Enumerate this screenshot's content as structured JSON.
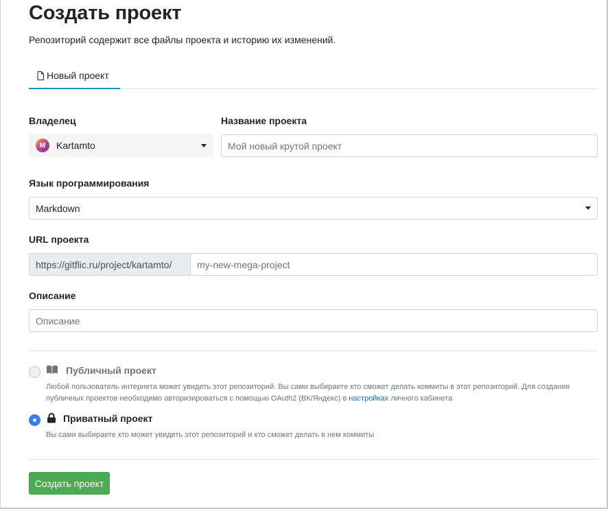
{
  "page": {
    "title": "Создать проект",
    "subtitle": "Репозиторий содержит все файлы проекта и историю их изменений."
  },
  "tabs": [
    {
      "label": "Новый проект",
      "active": true
    }
  ],
  "form": {
    "owner": {
      "label": "Владелец",
      "avatar_letter": "M",
      "value": "Kartamto"
    },
    "project_name": {
      "label": "Название проекта",
      "placeholder": "Мой новый крутой проект"
    },
    "language": {
      "label": "Язык программирования",
      "value": "Markdown"
    },
    "url": {
      "label": "URL проекта",
      "prefix": "https://gitflic.ru/project/kartamto/",
      "placeholder": "my-new-mega-project"
    },
    "description": {
      "label": "Описание",
      "placeholder": "Описание"
    }
  },
  "visibility": {
    "public": {
      "title": "Публичный проект",
      "icon": "book-icon",
      "selected": false,
      "description_line1": "Любой пользователь интернета может увидеть этот репозиторий. Вы сами выбираете кто сможет делать коммиты в этот репозиторий. Для создания",
      "description_line2_before": "публичных проектов необходимо авторизироваться с помощью OAuth2 (ВК/Яндекс) в ",
      "description_link": "настройках",
      "description_line2_after": " личного кабинета"
    },
    "private": {
      "title": "Приватный проект",
      "icon": "lock-icon",
      "selected": true,
      "description": "Вы сами выбираете кто может увидеть этот репозиторий и кто сможет делать в нем коммиты"
    }
  },
  "submit_label": "Создать проект",
  "colors": {
    "primary_tab": "#1f8fb5",
    "submit": "#4caa55",
    "radio_selected": "#3a7bf5",
    "link": "#1a6fb8"
  }
}
